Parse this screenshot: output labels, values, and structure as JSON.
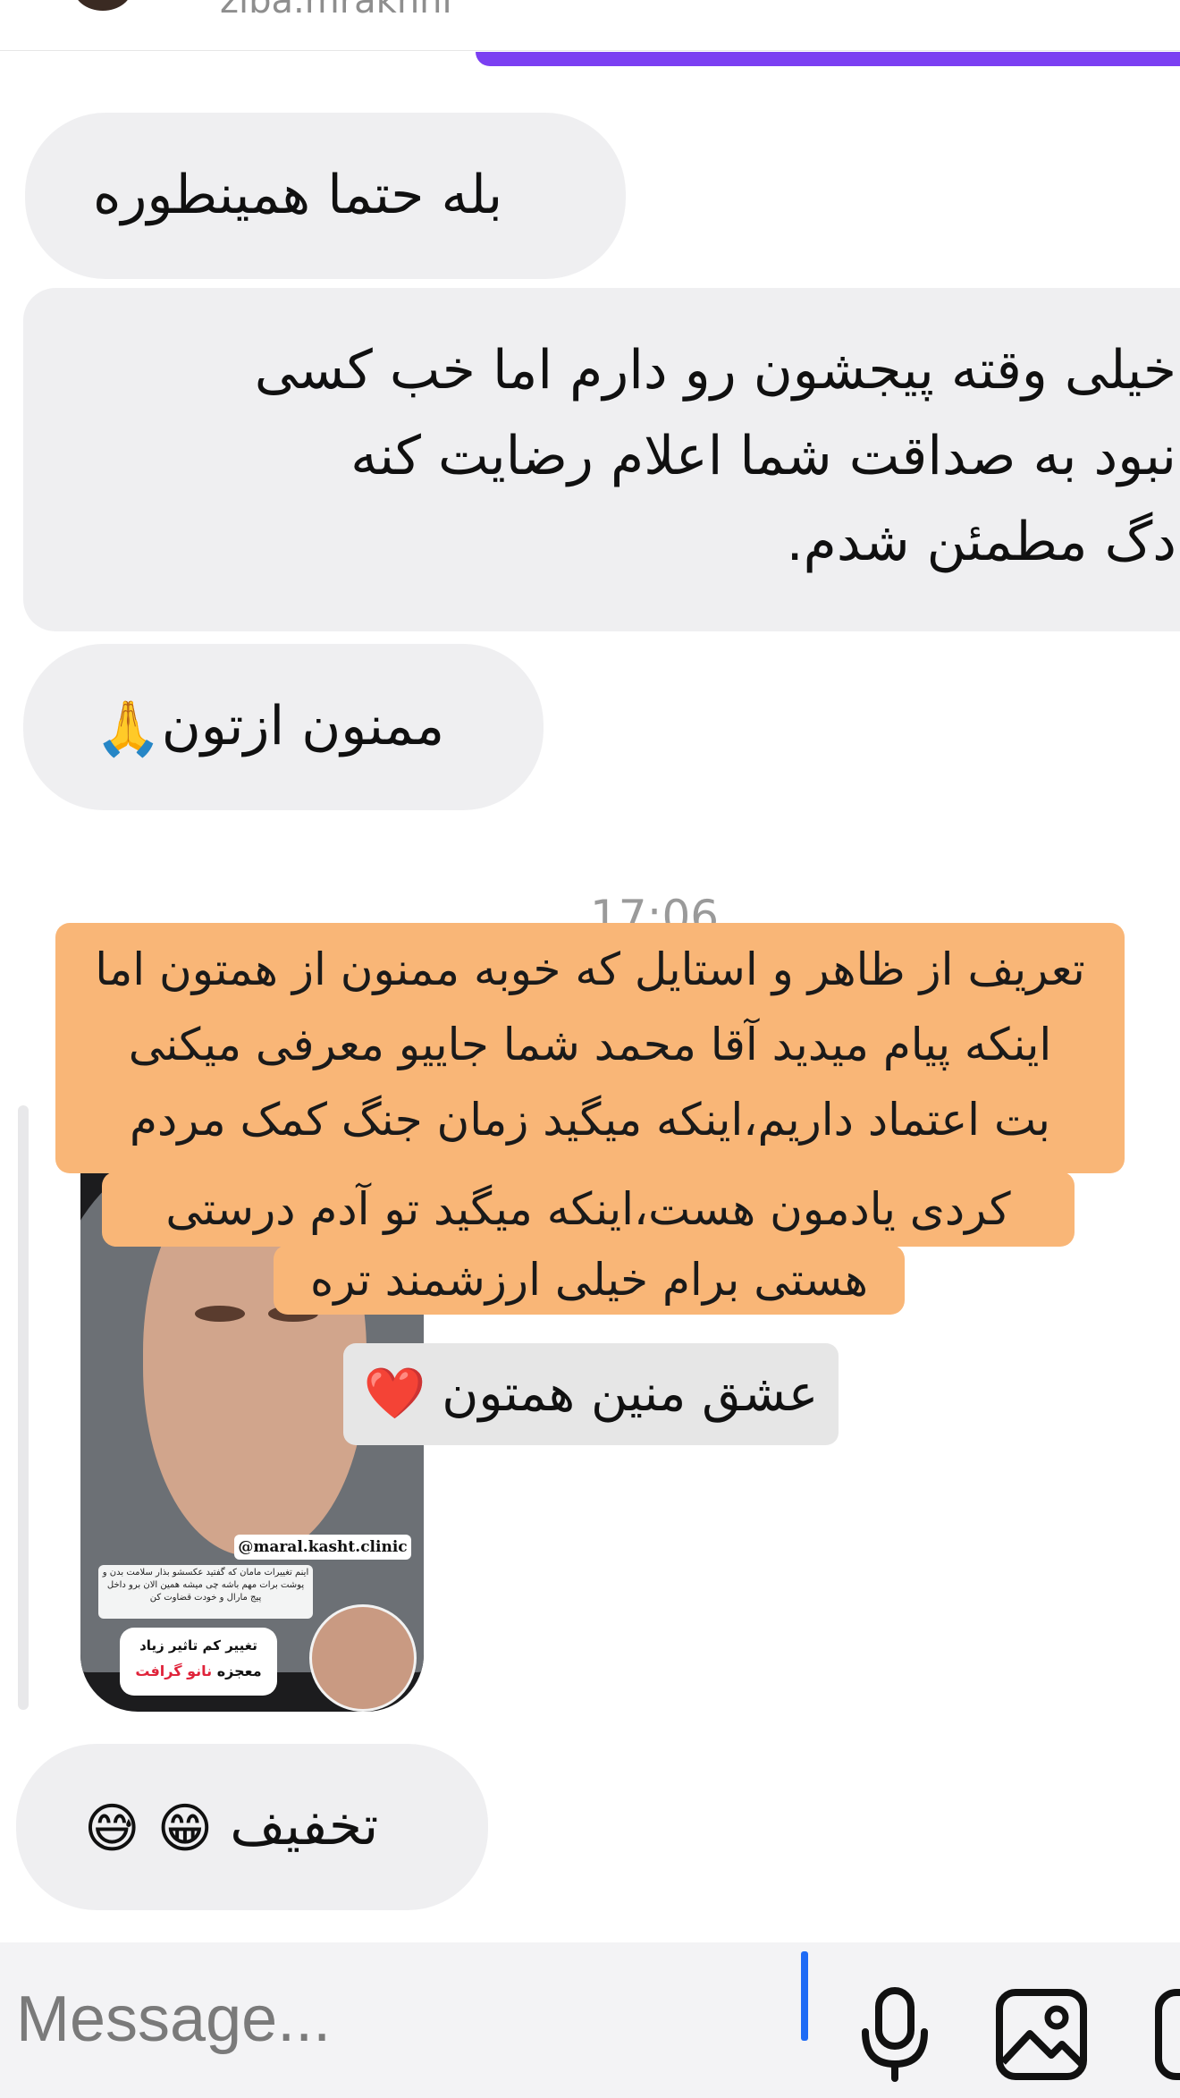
{
  "header": {
    "username": "ziba.mrakhni"
  },
  "messages": {
    "m1": "بله حتما همینطوره",
    "m2_line1": "خیلی وقته پیجشون رو دارم اما خب کسی",
    "m2_line2": "نبود به صداقت شما اعلام رضایت کنه",
    "m2_line3": "دگ مطمئن شدم.",
    "m3_text": "ممنون ازتون",
    "m3_emoji": "🙏",
    "m4_text": "تخفیف",
    "m4_emoji1": "😁",
    "m4_emoji2": "😅"
  },
  "timestamp": "17:06",
  "shared_post": {
    "handle": "@maral.kasht.clinic",
    "note": "اینم تغییرات مامان که گفتید عکسشو بذار سلامت بدن و پوشت برات مهم باشه چی میشه همین الان برو داخل پیج مارال و خودت قضاوت کن",
    "badge_line1": "تغییر کم تاثیر زیاد",
    "badge_line2_prefix": "معجزه",
    "badge_line2_highlight": "نانو گرافت"
  },
  "story_text": {
    "line1": "تعریف از ظاهر و استایل که خوبه ممنون از همتون اما",
    "line2": "اینکه پیام میدید آقا محمد شما جاییو معرفی میکنی",
    "line3": "بت اعتماد داریم،اینکه میگید زمان جنگ کمک مردم",
    "line4": "کردی یادمون هست،اینکه میگید تو آدم درستی",
    "line5": "هستی برام خیلی ارزشمند تره"
  },
  "story_label": {
    "text": "عشق منین همتون",
    "emoji": "❤️"
  },
  "composer": {
    "placeholder": "Message...",
    "icons": [
      "microphone-icon",
      "gallery-icon",
      "sticker-icon"
    ]
  },
  "colors": {
    "bubble": "#efeff1",
    "sticker": "#f9b677",
    "cursor": "#1e6bf5",
    "accent": "#7b3ff2"
  }
}
